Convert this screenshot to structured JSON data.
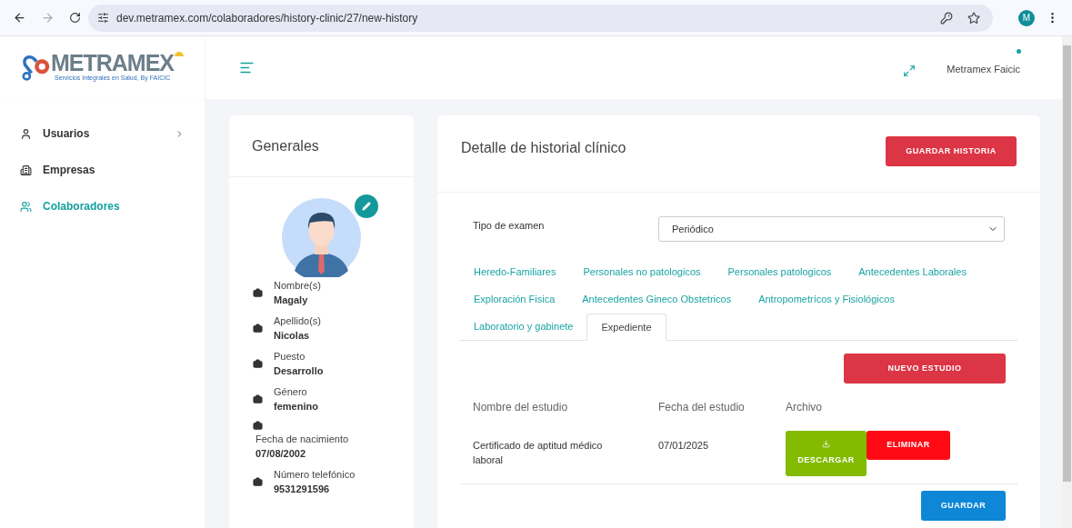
{
  "browser": {
    "url": "dev.metramex.com/colaboradores/history-clinic/27/new-history",
    "profile_initial": "M"
  },
  "logo": {
    "name": "METRAMEX",
    "tagline": "Servicios Integrales en Salud, By FAICIC"
  },
  "header": {
    "user_name": "Metramex Faicic"
  },
  "sidebar": {
    "items": [
      {
        "label": "Usuarios",
        "selected": false,
        "expandable": true
      },
      {
        "label": "Empresas",
        "selected": false,
        "expandable": false
      },
      {
        "label": "Colaboradores",
        "selected": true,
        "expandable": false
      }
    ]
  },
  "generales": {
    "title": "Generales",
    "fields": [
      {
        "kind": "inline",
        "label": "Nombre(s)",
        "value": "Magaly"
      },
      {
        "kind": "inline",
        "label": "Apellido(s)",
        "value": "Nicolas"
      },
      {
        "kind": "inline",
        "label": "Puesto",
        "value": "Desarrollo"
      },
      {
        "kind": "inline",
        "label": "Género",
        "value": "femenino"
      },
      {
        "kind": "stacked",
        "label": "Fecha de nacimiento",
        "value": "07/08/2002"
      },
      {
        "kind": "inline",
        "label": "Número telefónico",
        "value": "9531291596"
      }
    ]
  },
  "detail": {
    "title": "Detalle de historial clínico",
    "save_button": "GUARDAR HISTORIA",
    "exam_type": {
      "label": "Tipo de examen",
      "value": "Periódico"
    },
    "tab_rows": [
      [
        {
          "label": "Heredo-Familiares",
          "selected": false
        },
        {
          "label": "Personales no patologicos",
          "selected": false
        },
        {
          "label": "Personales patologicos",
          "selected": false
        },
        {
          "label": "Antecedentes Laborales",
          "selected": false
        }
      ],
      [
        {
          "label": "Exploración Fisica",
          "selected": false
        },
        {
          "label": "Antecedentes Gineco Obstetricos",
          "selected": false
        },
        {
          "label": "Antropometrícos y Fisiológicos",
          "selected": false
        }
      ],
      [
        {
          "label": "Laboratorio y gabinete",
          "selected": false
        },
        {
          "label": "Expediente",
          "selected": true
        }
      ]
    ],
    "new_button": "NUEVO ESTUDIO",
    "columns": [
      "Nombre del estudio",
      "Fecha del estudio",
      "Archivo"
    ],
    "rows": [
      {
        "name": "Certificado de aptitud médico laboral",
        "date": "07/01/2025",
        "download": "DESCARGAR",
        "delete": "ELIMINAR"
      }
    ],
    "save_button_bottom": "GUARDAR"
  }
}
